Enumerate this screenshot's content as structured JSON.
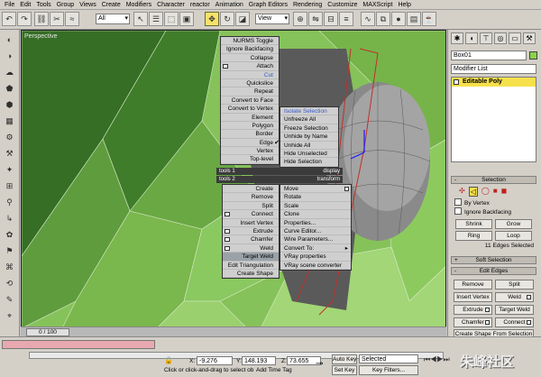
{
  "menubar": [
    "File",
    "Edit",
    "Tools",
    "Group",
    "Views",
    "Create",
    "Modifiers",
    "Character",
    "reactor",
    "Animation",
    "Graph Editors",
    "Rendering",
    "Customize",
    "MAXScript",
    "Help"
  ],
  "toolbar": {
    "selection_filter": "All",
    "ref_coord": "View"
  },
  "viewport": {
    "label": "Perspective"
  },
  "quad_left_top": [
    {
      "label": "NURMS Toggle"
    },
    {
      "label": "Ignore Backfacing"
    },
    {
      "label": "Collapse"
    },
    {
      "label": "Attach",
      "box": true
    },
    {
      "label": "Cut",
      "disabled": true
    },
    {
      "label": "Quickslice"
    },
    {
      "label": "Repeat"
    },
    {
      "label": "Convert to Face"
    },
    {
      "label": "Convert to Vertex"
    },
    {
      "label": "Element"
    },
    {
      "label": "Polygon"
    },
    {
      "label": "Border"
    },
    {
      "label": "Edge",
      "checked": true
    },
    {
      "label": "Vertex"
    },
    {
      "label": "Top-level"
    }
  ],
  "quad_right_top": [
    {
      "label": "Isolate Selection",
      "disabled": true
    },
    {
      "label": "Unfreeze All"
    },
    {
      "label": "Freeze Selection"
    },
    {
      "label": "Unhide by Name"
    },
    {
      "label": "Unhide All"
    },
    {
      "label": "Hide Unselected"
    },
    {
      "label": "Hide Selection"
    }
  ],
  "quad_headers": {
    "tools1": "tools 1",
    "display": "display",
    "tools2": "tools 2",
    "transform": "transform"
  },
  "quad_left_bottom": [
    {
      "label": "Create"
    },
    {
      "label": "Remove"
    },
    {
      "label": "Split"
    },
    {
      "label": "Connect",
      "box": true
    },
    {
      "label": "Insert Vertex"
    },
    {
      "label": "Extrude",
      "box": true
    },
    {
      "label": "Chamfer",
      "box": true
    },
    {
      "label": "Weld",
      "box": true
    },
    {
      "label": "Target Weld",
      "highlight": true
    },
    {
      "label": "Edit Triangulation"
    },
    {
      "label": "Create Shape"
    }
  ],
  "quad_right_bottom": [
    {
      "label": "Move",
      "box": true
    },
    {
      "label": "Rotate"
    },
    {
      "label": "Scale"
    },
    {
      "label": "Clone"
    },
    {
      "label": "Properties..."
    },
    {
      "label": "Curve Editor..."
    },
    {
      "label": "Wire Parameters..."
    },
    {
      "label": "Convert To:",
      "arrow": true
    },
    {
      "label": "VRay properties"
    },
    {
      "label": "VRay scene converter"
    }
  ],
  "panel": {
    "object_name": "Box01",
    "modifier_list": "Modifier List",
    "stack_item": "Editable Poly",
    "rollout_selection": "Selection",
    "by_vertex": "By Vertex",
    "ignore_backfacing": "Ignore Backfacing",
    "shrink": "Shrink",
    "grow": "Grow",
    "ring": "Ring",
    "loop": "Loop",
    "selected_count": "11 Edges Selected",
    "rollout_soft": "Soft Selection",
    "rollout_edit": "Edit Edges",
    "remove": "Remove",
    "split": "Split",
    "insert_vertex": "Insert Vertex",
    "weld": "Weld",
    "extrude": "Extrude",
    "target_weld": "Target Weld",
    "chamfer": "Chamfer",
    "connect": "Connect",
    "create_shape": "Create Shape From Selection"
  },
  "timeline": {
    "frame": "0 / 100"
  },
  "status": {
    "prompt": "Click or click-and-drag to select ob",
    "x": "-9.276",
    "y": "148.193",
    "z": "73.655",
    "auto_key": "Auto Key",
    "set_key": "Set Key",
    "key_mode": "Selected",
    "key_filters": "Key Filters...",
    "add_time_tag": "Add Time Tag"
  },
  "watermark": "朱峰社区"
}
